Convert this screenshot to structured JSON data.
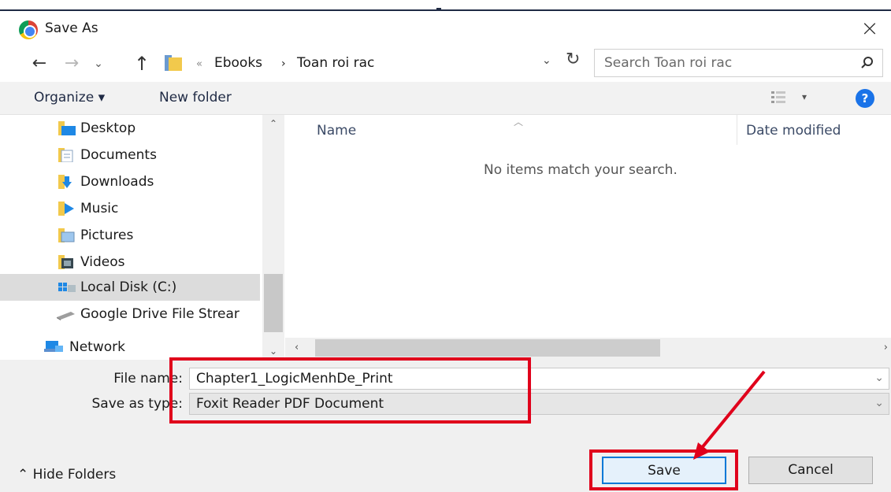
{
  "window": {
    "title": "Save As",
    "close_glyph": "×"
  },
  "address": {
    "crumb_separator_leading": "«",
    "crumbs": [
      "Ebooks",
      "Toan roi rac"
    ],
    "crumb_separator": "›",
    "search_placeholder": "Search Toan roi rac"
  },
  "toolbar": {
    "organize": "Organize ▾",
    "new_folder": "New folder",
    "help": "?"
  },
  "nav_pane": {
    "items": [
      {
        "label": "Desktop",
        "icon": "desktop-folder-icon"
      },
      {
        "label": "Documents",
        "icon": "documents-folder-icon"
      },
      {
        "label": "Downloads",
        "icon": "downloads-folder-icon"
      },
      {
        "label": "Music",
        "icon": "music-folder-icon"
      },
      {
        "label": "Pictures",
        "icon": "pictures-folder-icon"
      },
      {
        "label": "Videos",
        "icon": "videos-folder-icon"
      },
      {
        "label": "Local Disk (C:)",
        "icon": "local-disk-icon",
        "selected": true
      },
      {
        "label": "Google Drive File Strear",
        "icon": "drive-icon"
      },
      {
        "label": "Network",
        "icon": "network-icon"
      }
    ]
  },
  "file_list": {
    "columns": [
      "Name",
      "Date modified"
    ],
    "empty_message": "No items match your search."
  },
  "form": {
    "file_name_label": "File name:",
    "file_name_value": "Chapter1_LogicMenhDe_Print",
    "save_type_label": "Save as type:",
    "save_type_value": "Foxit Reader PDF Document"
  },
  "buttons": {
    "hide_folders": "Hide Folders",
    "save": "Save",
    "cancel": "Cancel"
  },
  "colors": {
    "annotation": "#e0001b",
    "accent": "#0078d7",
    "help_icon": "#1a73e8"
  }
}
